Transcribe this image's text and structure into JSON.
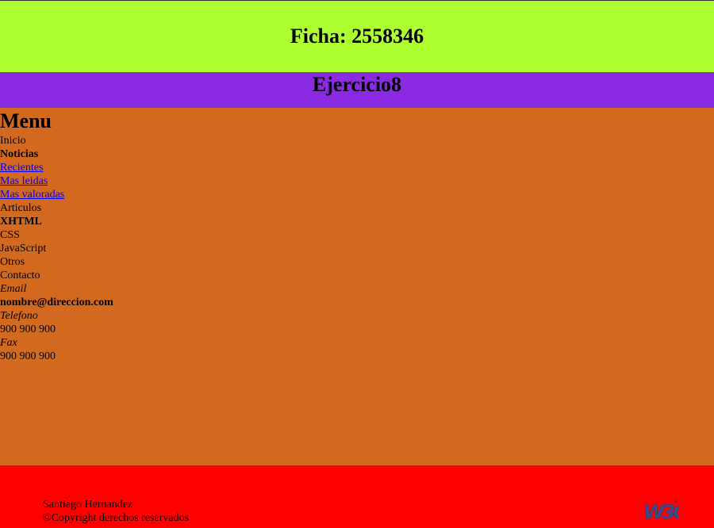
{
  "header": {
    "title": "Ficha: 2558346"
  },
  "subheader": {
    "title": "Ejercicio8"
  },
  "menu": {
    "title": "Menu",
    "inicio": "Inicio",
    "noticias_heading": "Noticias",
    "noticias_links": [
      "Recientes",
      "Mas leidas",
      "Mas valoradas"
    ],
    "articulos": "Articulos",
    "xhtml_heading": "XHTML",
    "xhtml_items": [
      "CSS",
      "JavaScript",
      "Otros"
    ],
    "contacto": "Contacto",
    "email_label": "Email",
    "email_value": "nombre@direccion.com",
    "telefono_label": "Telefono",
    "telefono_value": "900 900 900",
    "fax_label": "Fax",
    "fax_value": "900 900 900"
  },
  "footer": {
    "author": "Santiago Hernandez",
    "copyright": "©Copyright derechos reservados",
    "badge_icon": "w3c-logo-icon",
    "badge_text": "W3C"
  },
  "colors": {
    "header_bg": "#adff2f",
    "subheader_bg": "#8a2be2",
    "main_bg": "#d2691e",
    "footer_bg": "#ff0000",
    "link": "#0000ee"
  }
}
